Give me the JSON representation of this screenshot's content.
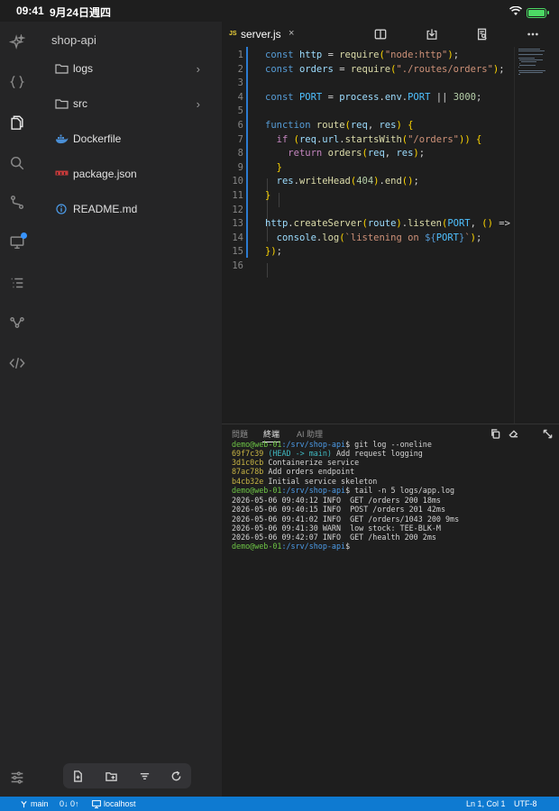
{
  "ios_status": {
    "time": "09:41",
    "date": "9月24日週四",
    "battery_level": 1.0
  },
  "activity_bar": {
    "items": [
      {
        "icon": "sparkle-icon",
        "active": false
      },
      {
        "icon": "braces-icon",
        "active": false
      },
      {
        "icon": "files-icon",
        "active": true
      },
      {
        "icon": "search-icon",
        "active": false
      },
      {
        "icon": "source-control-icon",
        "active": false
      },
      {
        "icon": "remote-monitor-icon",
        "active": false,
        "badge": true
      },
      {
        "icon": "outline-list-icon",
        "active": false
      },
      {
        "icon": "graph-icon",
        "active": false
      },
      {
        "icon": "code-icon",
        "active": false
      }
    ],
    "bottom_icon": "settings-sliders-icon"
  },
  "explorer": {
    "project": "shop-api",
    "items": [
      {
        "label": "logs",
        "icon": "folder-icon",
        "folder": true
      },
      {
        "label": "src",
        "icon": "folder-icon",
        "folder": true
      },
      {
        "label": "Dockerfile",
        "icon": "docker-icon",
        "folder": false
      },
      {
        "label": "package.json",
        "icon": "npm-icon",
        "folder": false
      },
      {
        "label": "README.md",
        "icon": "info-icon",
        "folder": false
      }
    ],
    "toolbar": [
      "new-file-icon",
      "new-folder-icon",
      "filter-icon",
      "refresh-icon"
    ]
  },
  "editor": {
    "tab": {
      "badge": "JS",
      "name": "server.js",
      "close": "×"
    },
    "line_numbers": [
      "1",
      "2",
      "3",
      "4",
      "5",
      "6",
      "7",
      "8",
      "9",
      "10",
      "11",
      "12",
      "13",
      "14",
      "15",
      "16"
    ],
    "code_lines": [
      "const http = require(\"node:http\");",
      "const orders = require(\"./routes/orders\");",
      "",
      "const PORT = process.env.PORT || 3000;",
      "",
      "function route(req, res) {",
      "  if (req.url.startsWith(\"/orders\")) {",
      "    return orders(req, res);",
      "  }",
      "  res.writeHead(404).end();",
      "}",
      "",
      "http.createServer(route).listen(PORT, () =>",
      "  console.log(`listening on ${PORT}`);",
      "});",
      ""
    ]
  },
  "panel": {
    "tabs": [
      "問題",
      "終端",
      "AI 助理"
    ],
    "active_tab": "終端",
    "terminal": {
      "prompt_user": "demo@web-01",
      "prompt_path": ":/srv/shop-api",
      "cmd1": "$ git log --oneline",
      "commits": [
        {
          "hash": "69f7c39",
          "ref": " (HEAD -> main)",
          "msg": " Add request logging"
        },
        {
          "hash": "3d1c0cb",
          "ref": "",
          "msg": " Containerize service"
        },
        {
          "hash": "87ac78b",
          "ref": "",
          "msg": " Add orders endpoint"
        },
        {
          "hash": "b4cb32e",
          "ref": "",
          "msg": " Initial service skeleton"
        }
      ],
      "cmd2": "$ tail -n 5 logs/app.log",
      "log_lines": [
        "2026-05-06 09:40:12 INFO  GET /orders 200 18ms",
        "2026-05-06 09:40:15 INFO  POST /orders 201 42ms",
        "2026-05-06 09:41:02 INFO  GET /orders/1043 200 9ms",
        "2026-05-06 09:41:30 WARN  low stock: TEE-BLK-M",
        "2026-05-06 09:42:07 INFO  GET /health 200 2ms"
      ],
      "final_prompt": "$"
    }
  },
  "statusbar": {
    "branch": "main",
    "sync": "0↓ 0↑",
    "remote": "localhost",
    "position": "Ln 1, Col 1",
    "encoding": "UTF-8"
  }
}
